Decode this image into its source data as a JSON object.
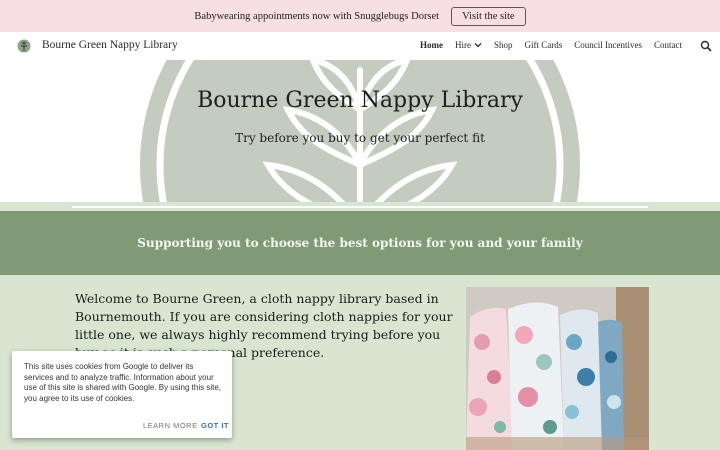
{
  "announcement": {
    "text": "Babywearing appointments now with Snugglebugs Dorset",
    "button_label": "Visit the site"
  },
  "header": {
    "site_title": "Bourne Green Nappy Library",
    "nav": [
      "Home",
      "Hire",
      "Shop",
      "Gift Cards",
      "Council Incentives",
      "Contact"
    ],
    "active_nav": "Home"
  },
  "hero": {
    "title": "Bourne Green Nappy Library",
    "subtitle": "Try before you buy to get your perfect fit"
  },
  "band": {
    "text": "Supporting you to choose the best options for you and your family"
  },
  "main": {
    "welcome_text": "Welcome to Bourne Green,  a cloth nappy library based in Bournemouth. If you are considering cloth nappies for your little one, we always highly recommend trying before you buy as it is such a personal preference."
  },
  "cookie": {
    "text": "This site uses cookies from Google to deliver its services and to analyze traffic. Information about your use of this site is shared with Google. By using this site, you agree to its use of cookies.",
    "learn_more": "LEARN MORE",
    "got_it": "GOT IT"
  },
  "colors": {
    "banner": "#f7dfe3",
    "band": "#7f9a74",
    "content_bg": "#d8e6d1",
    "cookie_accent": "#3a6fb0"
  }
}
